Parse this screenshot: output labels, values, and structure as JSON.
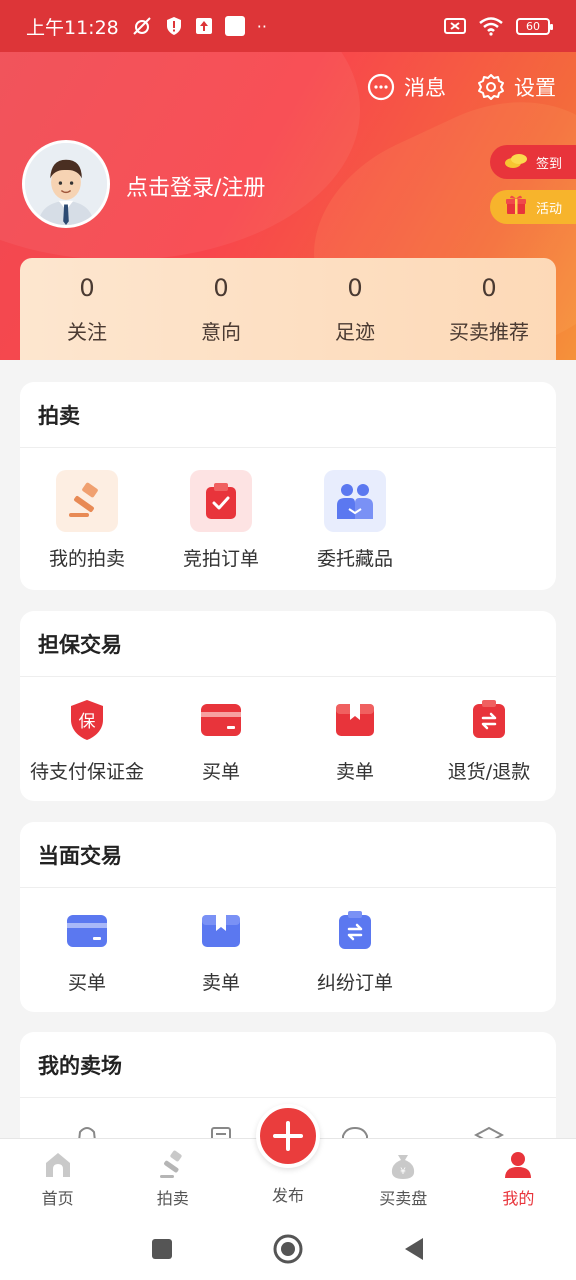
{
  "status_bar": {
    "time": "上午11:28",
    "battery": "60"
  },
  "header": {
    "messages_label": "消息",
    "settings_label": "设置",
    "login_text": "点击登录/注册",
    "sign_in_label": "签到",
    "activity_label": "活动"
  },
  "stats": [
    {
      "value": "0",
      "label": "关注"
    },
    {
      "value": "0",
      "label": "意向"
    },
    {
      "value": "0",
      "label": "足迹"
    },
    {
      "value": "0",
      "label": "买卖推荐"
    }
  ],
  "auction": {
    "title": "拍卖",
    "items": [
      {
        "label": "我的拍卖",
        "icon": "gavel-icon"
      },
      {
        "label": "竞拍订单",
        "icon": "clipboard-check-icon"
      },
      {
        "label": "委托藏品",
        "icon": "handshake-icon"
      }
    ]
  },
  "guarantee": {
    "title": "担保交易",
    "items": [
      {
        "label": "待支付保证金",
        "icon": "shield-bao-icon"
      },
      {
        "label": "买单",
        "icon": "card-icon"
      },
      {
        "label": "卖单",
        "icon": "box-icon"
      },
      {
        "label": "退货/退款",
        "icon": "refund-icon"
      }
    ]
  },
  "face_to_face": {
    "title": "当面交易",
    "items": [
      {
        "label": "买单",
        "icon": "card-icon"
      },
      {
        "label": "卖单",
        "icon": "box-icon"
      },
      {
        "label": "纠纷订单",
        "icon": "dispute-icon"
      }
    ]
  },
  "my_market": {
    "title": "我的卖场"
  },
  "tabbar": {
    "home": "首页",
    "auction": "拍卖",
    "publish": "发布",
    "market": "买卖盘",
    "mine": "我的"
  },
  "colors": {
    "primary": "#e8343b",
    "gold": "#f7b42c",
    "blue_icon": "#5b78f0",
    "stats_bg": "#fde6cf"
  }
}
